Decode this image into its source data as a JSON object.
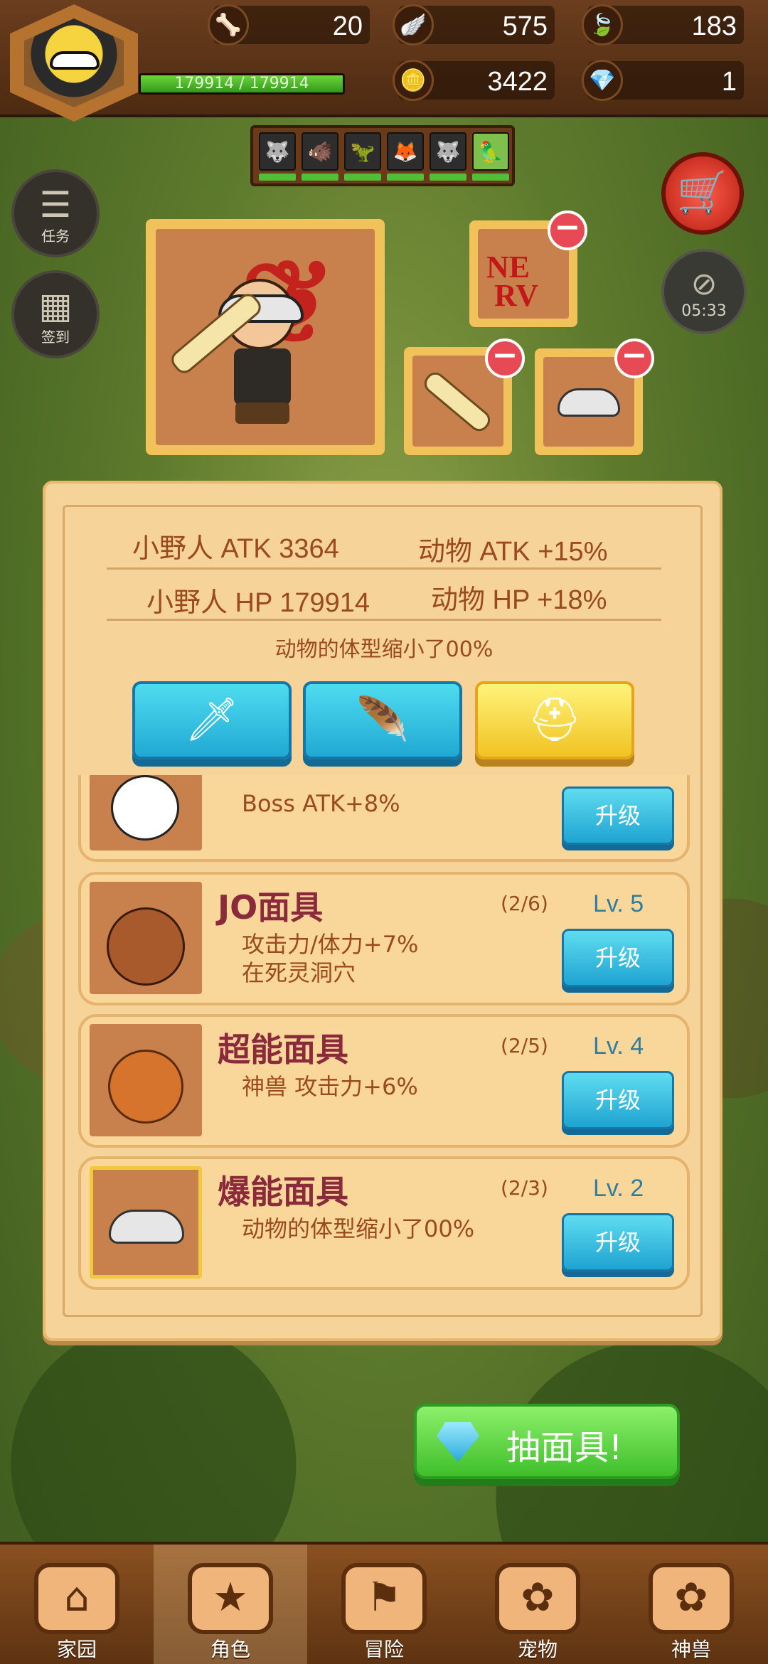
{
  "hud": {
    "hp_text": "179914 / 179914",
    "hp_fraction": 1.0,
    "resources": [
      {
        "icon": "bone-icon",
        "glyph": "🦴",
        "value": "20"
      },
      {
        "icon": "wing-icon",
        "glyph": "🪽",
        "value": "575"
      },
      {
        "icon": "leaf-icon",
        "glyph": "🍃",
        "value": "183"
      },
      {
        "icon": "coin-icon",
        "glyph": "🪙",
        "value": "3422"
      },
      {
        "icon": "gem-icon",
        "glyph": "💎",
        "value": "1"
      }
    ]
  },
  "side": {
    "task_label": "任务",
    "signin_label": "签到",
    "timer": "05:33"
  },
  "stats": {
    "hero_atk": "小野人 ATK 3364",
    "animal_atk": "动物 ATK +15%",
    "hero_hp": "小野人 HP 179914",
    "animal_hp": "动物 HP +18%",
    "shrink_note": "动物的体型缩小了00%"
  },
  "list": {
    "partial_desc": "Boss ATK+8%",
    "upgrade_label": "升级",
    "items": [
      {
        "name": "JO面具",
        "count": "(2/6)",
        "level": "Lv. 5",
        "desc": "攻击力/体力+7%\n在死灵洞穴"
      },
      {
        "name": "超能面具",
        "count": "(2/5)",
        "level": "Lv. 4",
        "desc": "神兽 攻击力+6%"
      },
      {
        "name": "爆能面具",
        "count": "(2/3)",
        "level": "Lv. 2",
        "desc": "动物的体型缩小了00%"
      }
    ]
  },
  "draw_button": "抽面具!",
  "nav": [
    {
      "label": "家园",
      "icon": "home-icon",
      "glyph": "⌂"
    },
    {
      "label": "角色",
      "icon": "cards-icon",
      "glyph": "★"
    },
    {
      "label": "冒险",
      "icon": "sign-icon",
      "glyph": "⚑"
    },
    {
      "label": "宠物",
      "icon": "paw-icon",
      "glyph": "✿"
    },
    {
      "label": "神兽",
      "icon": "beast-icon",
      "glyph": "✿"
    }
  ]
}
